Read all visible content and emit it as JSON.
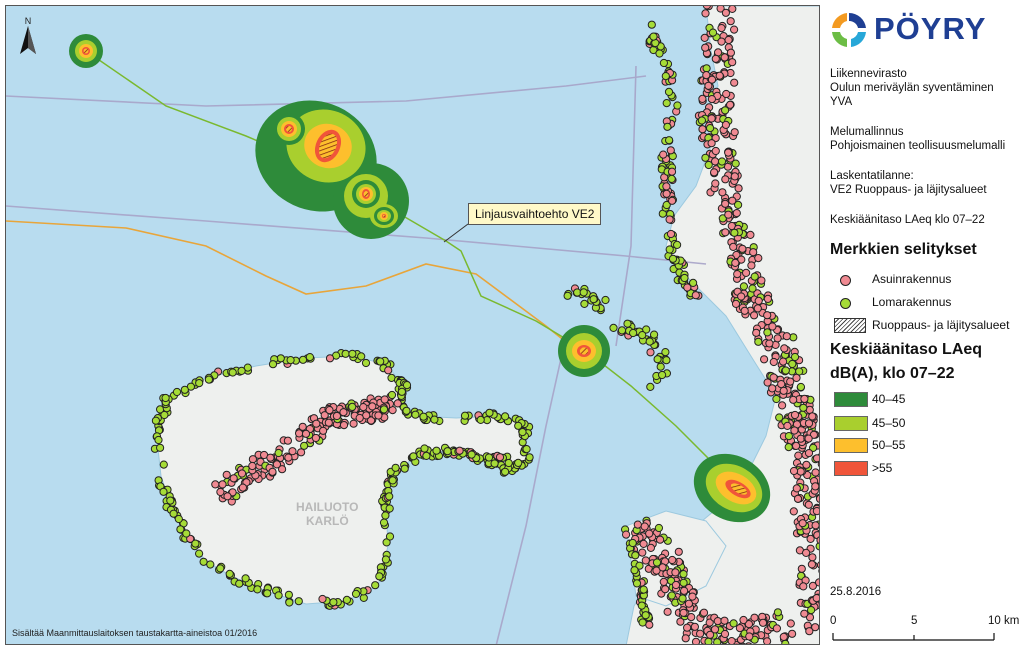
{
  "map": {
    "callout_label": "Linjausvaihtoehto VE2",
    "credit": "Sisältää Maanmittauslaitoksen taustakartta-aineistoa 01/2016",
    "north_label": "N",
    "place_labels": [
      "HAILUOTO",
      "KARLÖ"
    ],
    "colors": {
      "sea": "#b8dcef",
      "land": "#eef0ee",
      "route": "#7ab92f",
      "orange_line": "#e8a53a",
      "boundary": "#a7a3c8",
      "res_dot": "#f08a92",
      "leisure_dot": "#a6dc37"
    }
  },
  "panel": {
    "logo_text": "PÖYRY",
    "info_block_1": [
      "Liikennevirasto",
      "Oulun meriväylän syventäminen",
      "YVA"
    ],
    "info_block_2": [
      "Melumallinnus",
      "Pohjoismainen teollisuusmelumalli"
    ],
    "info_block_3": [
      "Laskentatilanne:",
      "VE2 Ruoppaus- ja läjitysalueet"
    ],
    "info_block_4": "Keskiäänitaso LAeq klo 07–22",
    "legend_title": "Merkkien selitykset",
    "legend_items": [
      {
        "label": "Asuinrakennus",
        "color": "#f08a92"
      },
      {
        "label": "Lomarakennus",
        "color": "#a6dc37"
      },
      {
        "label": "Ruoppaus- ja läjitysalueet"
      }
    ],
    "noise_title_1": "Keskiäänitaso LAeq",
    "noise_title_2": "dB(A), klo 07–22",
    "noise_classes": [
      {
        "label": "40–45",
        "color": "#2e8b3a"
      },
      {
        "label": "45–50",
        "color": "#a9cf2e"
      },
      {
        "label": "50–55",
        "color": "#fdbf2d"
      },
      {
        "label": ">55",
        "color": "#f0553a"
      }
    ],
    "date": "25.8.2016",
    "scale_labels": [
      "0",
      "5",
      "10 km"
    ]
  }
}
